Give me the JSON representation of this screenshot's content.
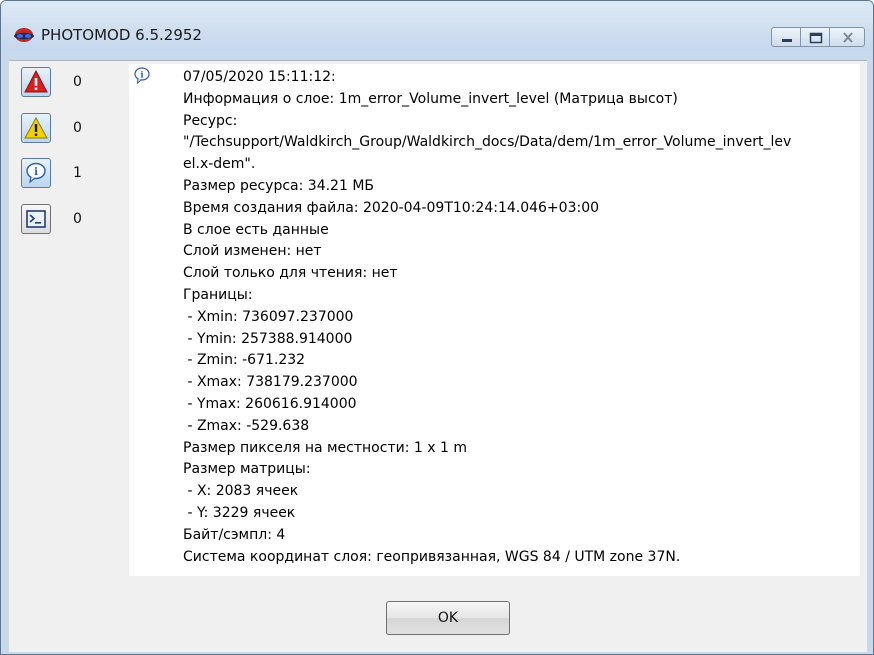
{
  "window": {
    "title": "PHOTOMOD 6.5.2952",
    "app_icon": "photomod-logo-icon",
    "controls": [
      "minimize-icon",
      "maximize-icon",
      "close-icon"
    ]
  },
  "sidebar": {
    "items": [
      {
        "icon": "error-icon",
        "count": "0"
      },
      {
        "icon": "warning-icon",
        "count": "0"
      },
      {
        "icon": "info-icon",
        "count": "1"
      },
      {
        "icon": "console-icon",
        "count": "0"
      }
    ]
  },
  "log": {
    "entry_icon": "info-icon",
    "lines": [
      "07/05/2020 15:11:12:",
      "Информация о слое: 1m_error_Volume_invert_level (Матрица высот)",
      "Ресурс:",
      "\"/Techsupport/Waldkirch_Group/Waldkirch_docs/Data/dem/1m_error_Volume_invert_lev",
      "el.x-dem\".",
      "Размер ресурса: 34.21 МБ",
      "Время создания файла: 2020-04-09T10:24:14.046+03:00",
      "В слое есть данные",
      "Слой изменен: нет",
      "Слой только для чтения: нет",
      "Границы:",
      " - Xmin: 736097.237000",
      " - Ymin: 257388.914000",
      " - Zmin: -671.232",
      " - Xmax: 738179.237000",
      " - Ymax: 260616.914000",
      " - Zmax: -529.638",
      "Размер пикселя на местности: 1 x 1 m",
      "Размер матрицы:",
      " - X: 2083 ячеек",
      " - Y: 3229 ячеек",
      "Байт/сэмпл: 4",
      "Система координат слоя: геопривязанная, WGS 84 / UTM zone 37N."
    ]
  },
  "footer": {
    "ok_label": "OK"
  },
  "colors": {
    "frame": "#c8d9ec",
    "client": "#f0f0f0",
    "error_red": "#d81e1e",
    "warning_yellow": "#f2d100"
  }
}
